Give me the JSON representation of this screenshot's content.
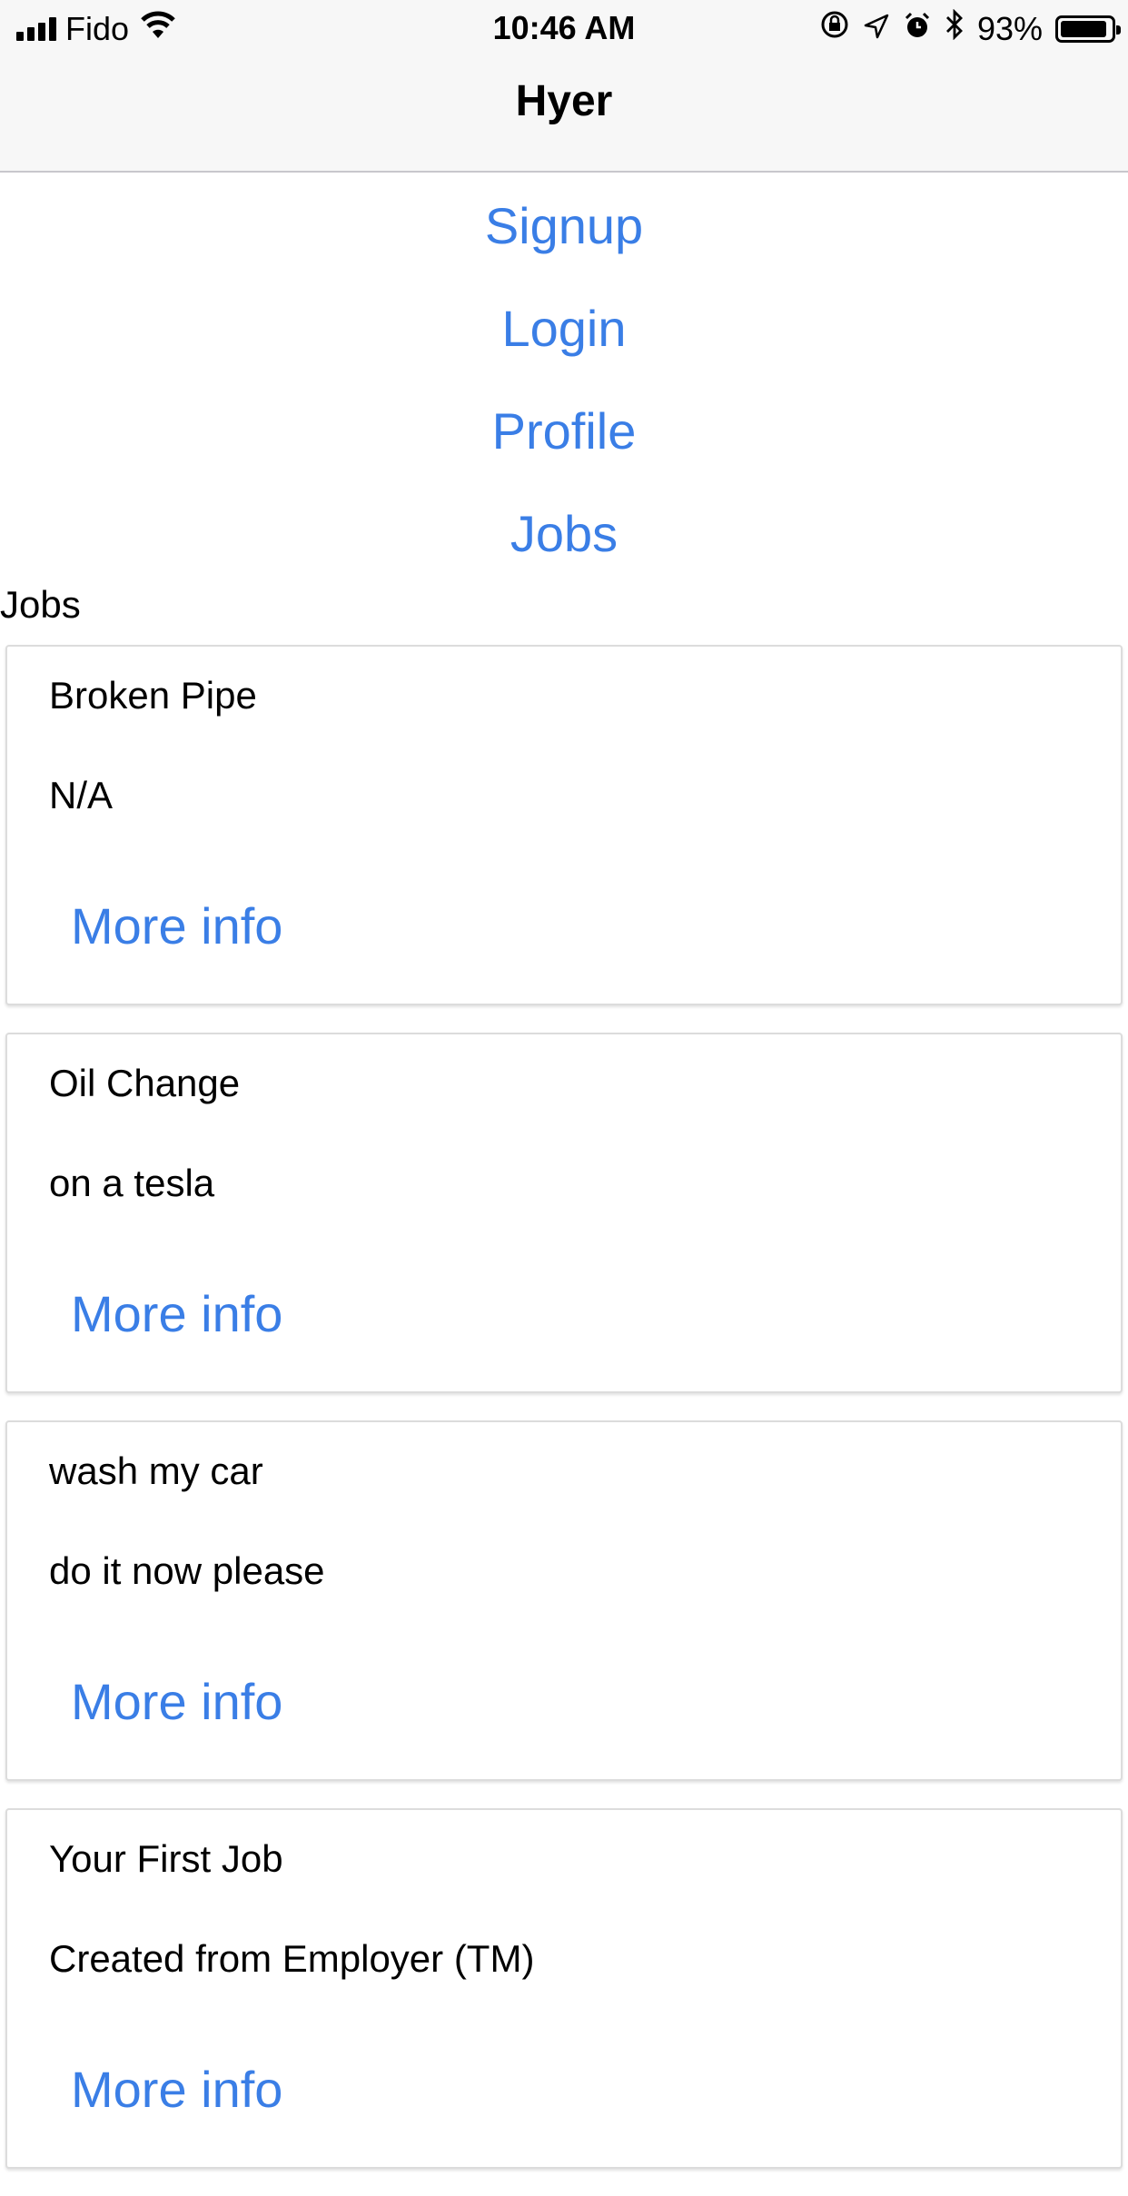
{
  "status_bar": {
    "carrier": "Fido",
    "time": "10:46 AM",
    "battery_percent": "93%",
    "battery_level": 0.93,
    "icons": [
      "signal-icon",
      "wifi-icon",
      "orientation-lock-icon",
      "location-icon",
      "alarm-icon",
      "bluetooth-icon",
      "battery-icon"
    ]
  },
  "header": {
    "title": "Hyer"
  },
  "nav": {
    "signup": "Signup",
    "login": "Login",
    "profile": "Profile",
    "jobs": "Jobs"
  },
  "jobs_section": {
    "label": "Jobs",
    "cards": [
      {
        "title": "Broken Pipe",
        "description": "N/A",
        "link": "More info"
      },
      {
        "title": "Oil Change",
        "description": "on a tesla",
        "link": "More info"
      },
      {
        "title": "wash my car",
        "description": "do it now please",
        "link": "More info"
      },
      {
        "title": "Your First Job",
        "description": "Created from Employer (TM)",
        "link": "More info"
      }
    ]
  },
  "colors": {
    "link": "#3a7ee6",
    "navbar_bg": "#f7f7f7",
    "card_border": "#dcdcdc"
  }
}
